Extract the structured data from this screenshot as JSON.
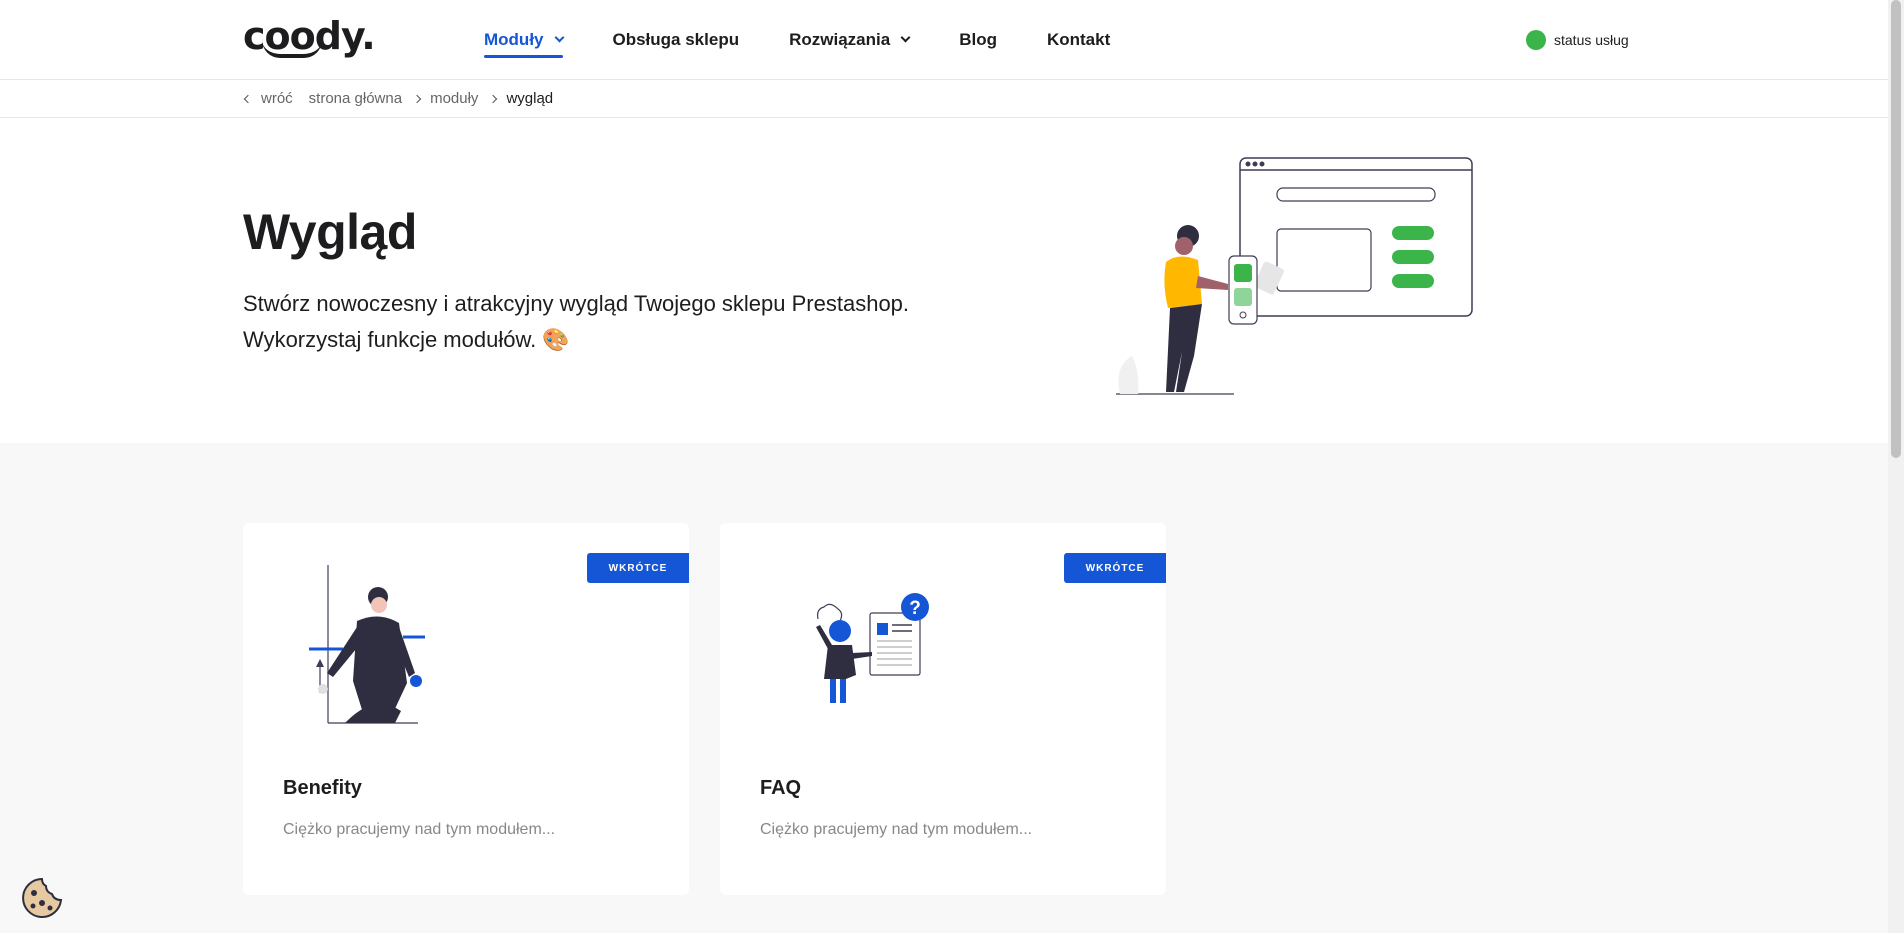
{
  "brand": {
    "logo": "coody."
  },
  "nav": {
    "items": [
      {
        "label": "Moduły",
        "has_dropdown": true,
        "active": true
      },
      {
        "label": "Obsługa sklepu",
        "has_dropdown": false
      },
      {
        "label": "Rozwiązania",
        "has_dropdown": true
      },
      {
        "label": "Blog",
        "has_dropdown": false
      },
      {
        "label": "Kontakt",
        "has_dropdown": false
      }
    ],
    "status_label": "status usług"
  },
  "breadcrumb": {
    "back": "wróć",
    "items": [
      "strona główna",
      "moduły"
    ],
    "current": "wygląd"
  },
  "hero": {
    "title": "Wygląd",
    "description": "Stwórz nowoczesny i atrakcyjny wygląd Twojego sklepu Prestashop. Wykorzystaj funkcje modułów. 🎨"
  },
  "cards": [
    {
      "title": "Benefity",
      "badge": "WKRÓTCE",
      "description": "Ciężko pracujemy nad tym modułem..."
    },
    {
      "title": "FAQ",
      "badge": "WKRÓTCE",
      "description": "Ciężko pracujemy nad tym modułem..."
    }
  ],
  "colors": {
    "accent": "#1556d6",
    "status": "#3bb54a",
    "background_light": "#f8f8f8"
  },
  "icons": [
    "chevron-down-icon",
    "chevron-left-icon",
    "chevron-right-icon",
    "cookie-icon",
    "palette-emoji"
  ]
}
